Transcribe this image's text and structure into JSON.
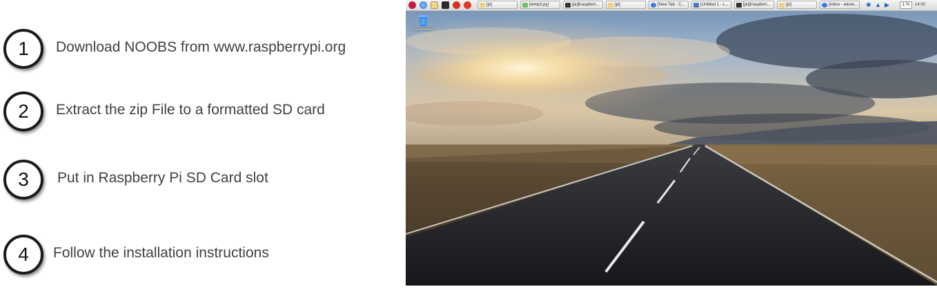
{
  "steps": [
    {
      "number": "1",
      "text": "Download NOOBS from www.raspberrypi.org"
    },
    {
      "number": "2",
      "text": "Extract the zip File to a formatted SD card"
    },
    {
      "number": "3",
      "text": "Put in Raspberry Pi SD Card slot"
    },
    {
      "number": "4",
      "text": "Follow the installation instructions"
    }
  ],
  "desktop": {
    "launcher_icons": [
      "raspberry-menu-icon",
      "web-browser-icon",
      "file-manager-icon",
      "terminal-icon",
      "debug-icon",
      "wolfram-icon"
    ],
    "tasks": [
      {
        "label": "[pi]",
        "icon": "folder-icon"
      },
      {
        "label": "[temp3.py]",
        "icon": "editor-icon"
      },
      {
        "label": "[pi@raspberr...",
        "icon": "terminal-icon"
      },
      {
        "label": "[pi]",
        "icon": "folder-icon"
      },
      {
        "label": "[New Tab - C...",
        "icon": "chromium-icon"
      },
      {
        "label": "[Untitled 1 - L...",
        "icon": "document-icon"
      },
      {
        "label": "[pi@raspberr...",
        "icon": "terminal-icon"
      },
      {
        "label": "[pi]",
        "icon": "folder-icon"
      },
      {
        "label": "[Inbox - edure...",
        "icon": "chromium-icon"
      }
    ],
    "tray": {
      "cpu": "1 %",
      "clock": "14:00"
    },
    "trash_label": "Wastebasket"
  },
  "colors": {
    "step_text": "#404040",
    "circle_border": "#1a1a1a",
    "taskbar": "#e6e6e6"
  }
}
